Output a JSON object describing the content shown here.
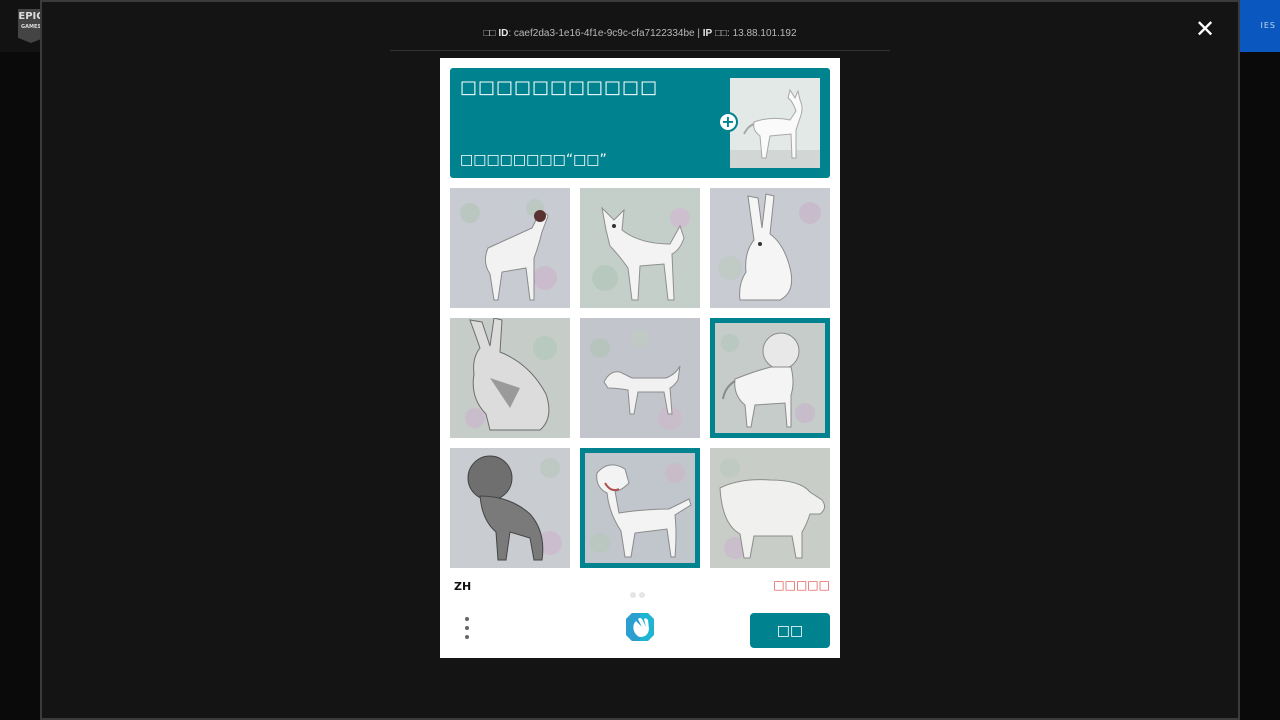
{
  "header": {
    "logo_top": "EPIC",
    "logo_bottom": "GAMES",
    "cta_fragment": "IES"
  },
  "modal": {
    "close_symbol": "✕",
    "request_info": {
      "id_prefix": "□□ ",
      "id_label": "ID",
      "id_value": ": caef2da3-1e16-4f1e-9c9c-cfa7122334be | ",
      "ip_label": "IP",
      "ip_value": " □□: 13.88.101.192"
    }
  },
  "captcha": {
    "title": "□□□□□□□□□□□",
    "subtitle": "□□□□□□□□“□□”",
    "add_example_symbol": "+",
    "language": "ZH",
    "skip_label": "□□□□□",
    "verify_label": "□□",
    "accent_color": "#00838f",
    "tiles": [
      {
        "name": "tile-goat",
        "animal": "goat",
        "selected": false
      },
      {
        "name": "tile-dog-1",
        "animal": "dog",
        "selected": false
      },
      {
        "name": "tile-rabbit-1",
        "animal": "rabbit",
        "selected": false
      },
      {
        "name": "tile-rabbit-2",
        "animal": "rabbit",
        "selected": false
      },
      {
        "name": "tile-dog-2",
        "animal": "dog",
        "selected": false
      },
      {
        "name": "tile-lion-1",
        "animal": "lion",
        "selected": true
      },
      {
        "name": "tile-lion-2",
        "animal": "lion",
        "selected": false
      },
      {
        "name": "tile-dog-3",
        "animal": "dog",
        "selected": true
      },
      {
        "name": "tile-cow",
        "animal": "cow",
        "selected": false
      }
    ]
  }
}
